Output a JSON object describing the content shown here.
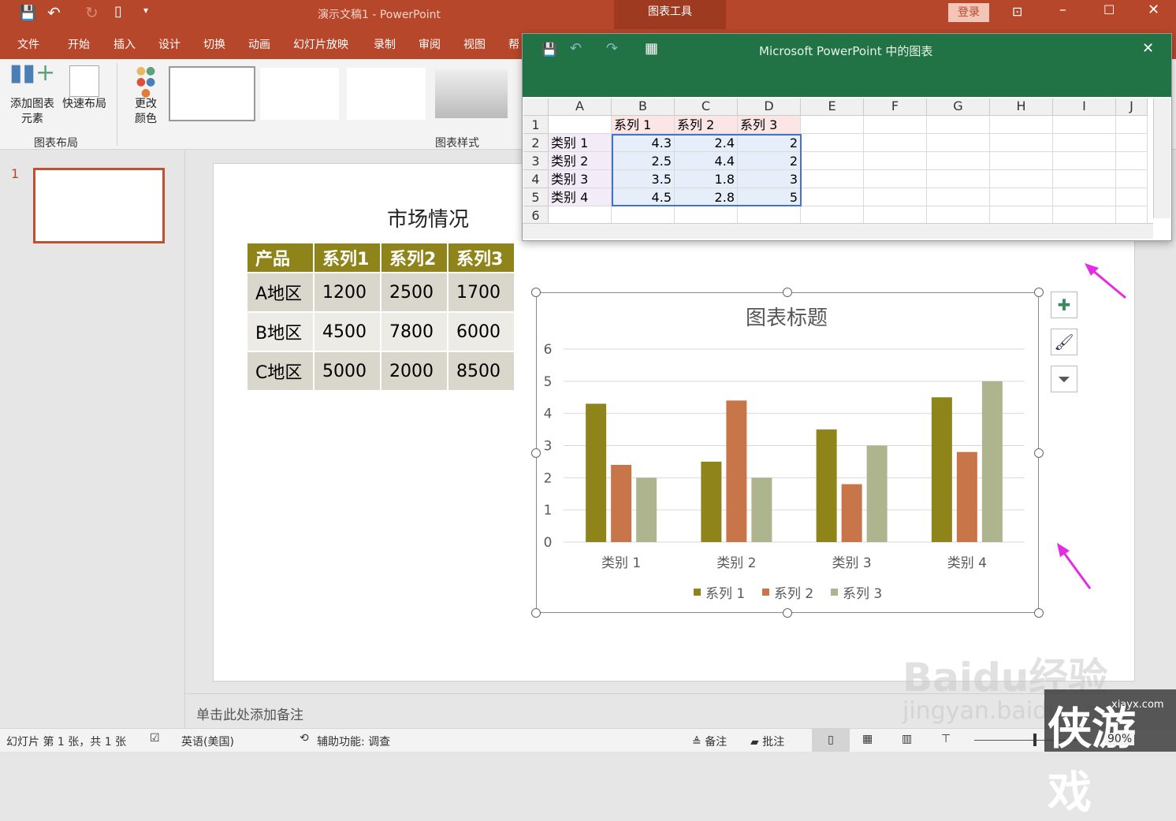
{
  "titlebar": {
    "doc_title": "演示文稿1 - PowerPoint",
    "context_tab": "图表工具",
    "login": "登录"
  },
  "menu": [
    "文件",
    "开始",
    "插入",
    "设计",
    "切换",
    "动画",
    "幻灯片放映",
    "录制",
    "审阅",
    "视图",
    "帮"
  ],
  "ribbon": {
    "add_element": "添加图表\n元素",
    "quick_layout": "快速布局",
    "change_color": "更改\n颜色",
    "group_layout": "图表布局",
    "group_styles": "图表样式"
  },
  "thumbs": {
    "slide_number": "1"
  },
  "slide": {
    "title": "市场情况",
    "table": {
      "headers": [
        "产品",
        "系列1",
        "系列2",
        "系列3"
      ],
      "rows": [
        [
          "A地区",
          "1200",
          "2500",
          "1700"
        ],
        [
          "B地区",
          "4500",
          "7800",
          "6000"
        ],
        [
          "C地区",
          "5000",
          "2000",
          "8500"
        ]
      ]
    }
  },
  "chart_data": {
    "type": "bar",
    "title": "图表标题",
    "categories": [
      "类别 1",
      "类别 2",
      "类别 3",
      "类别 4"
    ],
    "series": [
      {
        "name": "系列 1",
        "values": [
          4.3,
          2.5,
          3.5,
          4.5
        ],
        "color": "#8f841a"
      },
      {
        "name": "系列 2",
        "values": [
          2.4,
          4.4,
          1.8,
          2.8
        ],
        "color": "#c87549"
      },
      {
        "name": "系列 3",
        "values": [
          2,
          2,
          3,
          5
        ],
        "color": "#aeb48e"
      }
    ],
    "ylim": [
      0,
      6
    ],
    "yticks": [
      "0",
      "1",
      "2",
      "3",
      "4",
      "5",
      "6"
    ],
    "grid": true,
    "legend": "bottom"
  },
  "excel": {
    "title": "Microsoft PowerPoint 中的图表",
    "columns": [
      "A",
      "B",
      "C",
      "D",
      "E",
      "F",
      "G",
      "H",
      "I",
      "J"
    ],
    "row_numbers": [
      "1",
      "2",
      "3",
      "4",
      "5",
      "6"
    ],
    "rows": [
      [
        "",
        "系列 1",
        "系列 2",
        "系列 3"
      ],
      [
        "类别 1",
        "4.3",
        "2.4",
        "2"
      ],
      [
        "类别 2",
        "2.5",
        "4.4",
        "2"
      ],
      [
        "类别 3",
        "3.5",
        "1.8",
        "3"
      ],
      [
        "类别 4",
        "4.5",
        "2.8",
        "5"
      ]
    ]
  },
  "notes": {
    "placeholder": "单击此处添加备注"
  },
  "status": {
    "slide_info": "幻灯片 第 1 张，共 1 张",
    "language": "英语(美国)",
    "accessibility": "辅助功能: 调查",
    "notes": "备注",
    "comments": "批注",
    "zoom": "90%"
  },
  "watermark": {
    "baidu": "Baidu经验",
    "jingyan": "jingyan.baidu.com",
    "xiayx": "xiayx.com",
    "youxi": "侠游戏"
  }
}
